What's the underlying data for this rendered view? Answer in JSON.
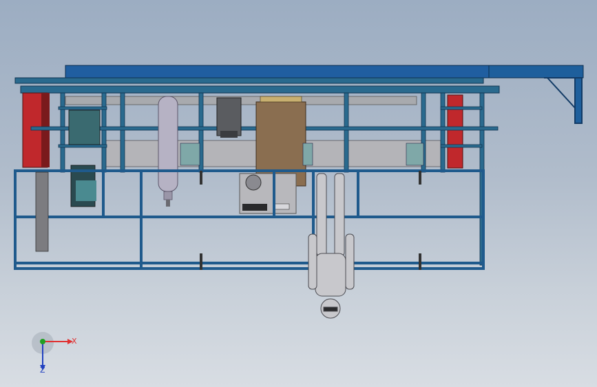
{
  "viewport": {
    "background_top": "#9cadc2",
    "background_bottom": "#d8dde3"
  },
  "model": {
    "frame_color": "#1f5a8c",
    "beam_color": "#1e5f9c",
    "red_panel_color": "#c0282c",
    "tan_panel_color": "#8a6e50",
    "tank_color": "#b6b2c4",
    "rail_color": "#b4b4b8",
    "figure_color": "#c8c8cc"
  },
  "triad": {
    "x_label": "X",
    "z_label": "Z",
    "x_color": "#e03030",
    "z_color": "#2040c0",
    "y_color": "#20a020"
  }
}
